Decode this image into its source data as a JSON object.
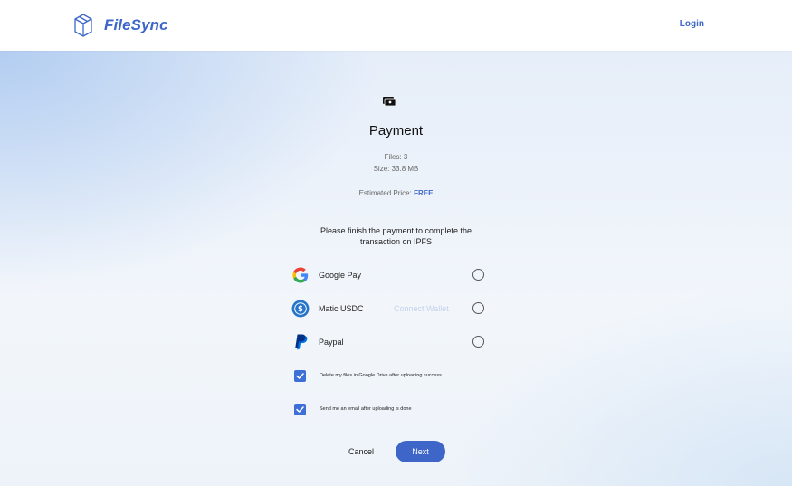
{
  "header": {
    "brand_name": "FileSync",
    "login_label": "Login"
  },
  "payment": {
    "title": "Payment",
    "files": "Files: 3",
    "size": "Size: 33.8 MB",
    "estimated_price_label": "Estimated Price: ",
    "estimated_price_value": "FREE",
    "instruction_line1": "Please finish the payment to complete the",
    "instruction_line2": "transaction on IPFS"
  },
  "options": [
    {
      "label": "Google Pay",
      "icon": "google-icon"
    },
    {
      "label": "Matic USDC",
      "icon": "usdc-icon",
      "action": "Connect Wallet"
    },
    {
      "label": "Paypal",
      "icon": "paypal-icon"
    }
  ],
  "checkboxes": [
    {
      "label": "Delete my files in Google Drive after uploading success",
      "checked": true
    },
    {
      "label": "Send me an email after uploading is done",
      "checked": true
    }
  ],
  "actions": {
    "cancel_label": "Cancel",
    "next_label": "Next"
  },
  "colors": {
    "accent": "#3d66c8",
    "checkbox": "#3d6fd6"
  }
}
